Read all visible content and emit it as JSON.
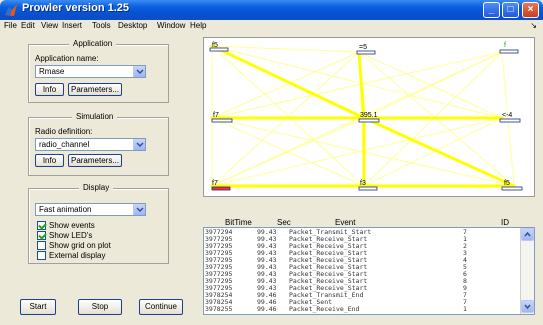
{
  "window": {
    "title": "Prowler version 1.25",
    "icon": "matlab-icon",
    "min_glyph": "_",
    "max_glyph": "□",
    "close_glyph": "×"
  },
  "menu": {
    "items": [
      "File",
      "Edit",
      "View",
      "Insert",
      "Tools",
      "Desktop",
      "Window",
      "Help"
    ],
    "overflow": "↘"
  },
  "application": {
    "title": "Application",
    "name_label": "Application name:",
    "selected": "Rmase",
    "info_label": "Info",
    "params_label": "Parameters..."
  },
  "simulation": {
    "title": "Simulation",
    "radio_label": "Radio definition:",
    "selected": "radio_channel",
    "info_label": "Info",
    "params_label": "Parameters..."
  },
  "display": {
    "title": "Display",
    "selected": "Fast animation",
    "checks": [
      {
        "label": "Show events",
        "checked": true
      },
      {
        "label": "Show LED's",
        "checked": true
      },
      {
        "label": "Show grid on plot",
        "checked": false
      },
      {
        "label": "External display",
        "checked": false
      }
    ]
  },
  "controls": {
    "start_label": "Start",
    "stop_label": "Stop",
    "continue_label": "Continue"
  },
  "plot": {
    "line_color": "#ffff00",
    "line_color_light": "#ffff99",
    "node_labels": [
      "f5",
      "=5",
      "f",
      "f7",
      "395.1",
      "<-4",
      "f7",
      "f3",
      "f5"
    ]
  },
  "log": {
    "headers": {
      "bittime": "BitTime",
      "sec": "Sec",
      "event": "Event",
      "id": "ID"
    },
    "rows": [
      {
        "bittime": "3977294",
        "sec": "99.43",
        "event": "Packet_Transmit_Start",
        "id": "7"
      },
      {
        "bittime": "3977295",
        "sec": "99.43",
        "event": "Packet_Receive_Start",
        "id": "1"
      },
      {
        "bittime": "3977295",
        "sec": "99.43",
        "event": "Packet_Receive_Start",
        "id": "2"
      },
      {
        "bittime": "3977295",
        "sec": "99.43",
        "event": "Packet_Receive_Start",
        "id": "3"
      },
      {
        "bittime": "3977295",
        "sec": "99.43",
        "event": "Packet_Receive_Start",
        "id": "4"
      },
      {
        "bittime": "3977295",
        "sec": "99.43",
        "event": "Packet_Receive_Start",
        "id": "5"
      },
      {
        "bittime": "3977295",
        "sec": "99.43",
        "event": "Packet_Receive_Start",
        "id": "6"
      },
      {
        "bittime": "3977295",
        "sec": "99.43",
        "event": "Packet_Receive_Start",
        "id": "8"
      },
      {
        "bittime": "3977295",
        "sec": "99.43",
        "event": "Packet_Receive_Start",
        "id": "9"
      },
      {
        "bittime": "3978254",
        "sec": "99.46",
        "event": "Packet_Transmit_End",
        "id": "7"
      },
      {
        "bittime": "3978254",
        "sec": "99.46",
        "event": "Packet_Sent",
        "id": "7"
      },
      {
        "bittime": "3978255",
        "sec": "99.46",
        "event": "Packet_Receive_End",
        "id": "1"
      }
    ]
  }
}
